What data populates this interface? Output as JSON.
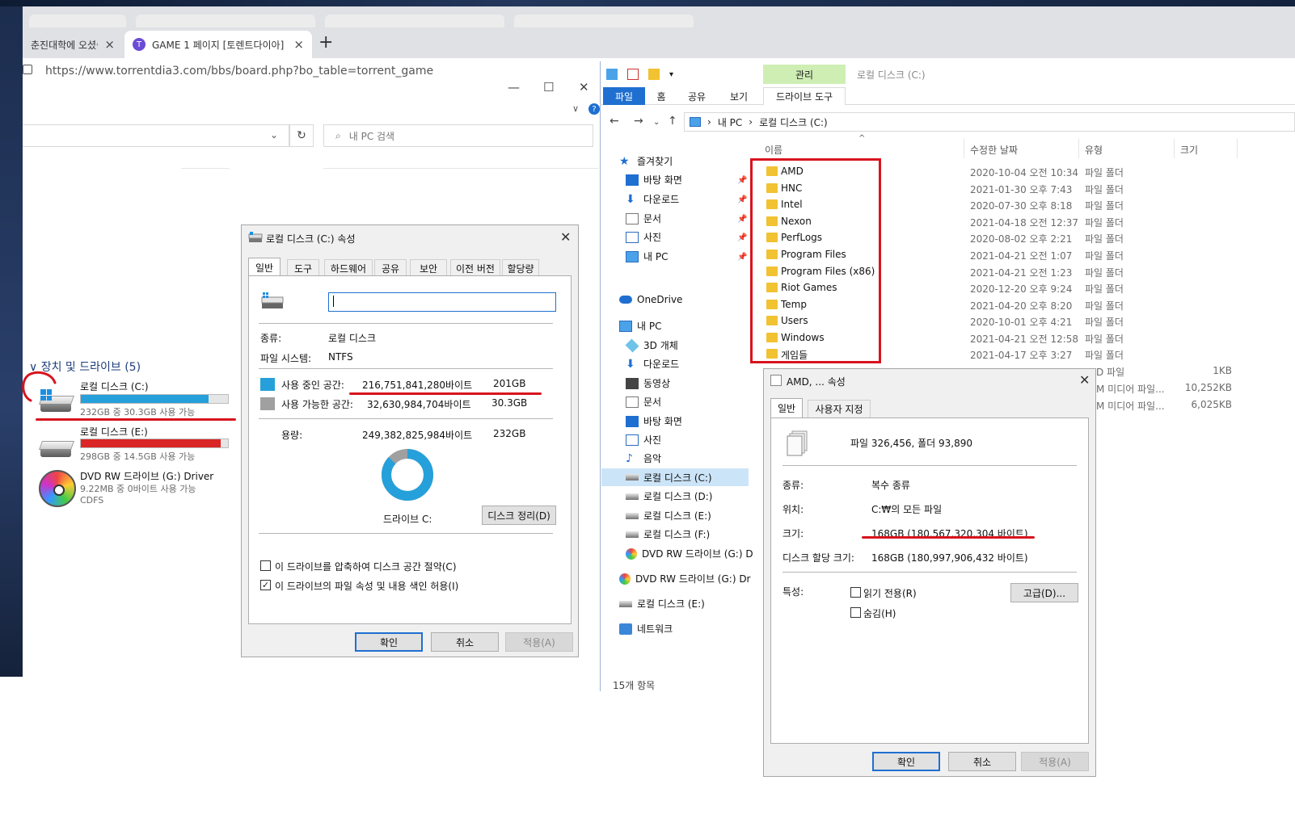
{
  "browser": {
    "tabs": [
      {
        "label": "춘진대학에 오셨습니"
      },
      {
        "label": "GAME 1 페이지 [토렌트다이아]"
      }
    ],
    "new_tab": "+",
    "close_glyph": "×",
    "favicon_letter": "T",
    "url": "https://www.torrentdia3.com/bbs/board.php?bo_table=torrent_game"
  },
  "pc_window": {
    "search_placeholder": "내 PC 검색",
    "section_title": "장치 및 드라이브 (5)",
    "drives": [
      {
        "name": "로컬 디스크 (C:)",
        "detail": "232GB 중 30.3GB 사용 가능",
        "used_fraction": 0.87,
        "bar_color": "#26a0da"
      },
      {
        "name": "로컬 디스크 (E:)",
        "detail": "298GB 중 14.5GB 사용 가능",
        "used_fraction": 0.95,
        "bar_color": "#da2626"
      },
      {
        "name": "DVD RW 드라이브 (G:) Driver",
        "detail": "9.22MB 중 0바이트 사용 가능",
        "detail2": "CDFS"
      }
    ]
  },
  "props_c": {
    "title": "로컬 디스크 (C:) 속성",
    "tabs": [
      "일반",
      "도구",
      "하드웨어",
      "공유",
      "보안",
      "이전 버전",
      "할당량"
    ],
    "name_value": "",
    "type_label": "종류:",
    "type_value": "로컬 디스크",
    "fs_label": "파일 시스템:",
    "fs_value": "NTFS",
    "used_label": "사용 중인 공간:",
    "used_bytes": "216,751,841,280바이트",
    "used_gb": "201GB",
    "free_label": "사용 가능한 공간:",
    "free_bytes": "32,630,984,704바이트",
    "free_gb": "30.3GB",
    "cap_label": "용량:",
    "cap_bytes": "249,382,825,984바이트",
    "cap_gb": "232GB",
    "used_fraction": 0.869,
    "used_color": "#26a0da",
    "free_color": "#a0a0a0",
    "drive_label": "드라이브 C:",
    "cleanup": "디스크 정리(D)",
    "compress": "이 드라이브를 압축하여 디스크 공간 절약(C)",
    "index": "이 드라이브의 파일 속성 및 내용 색인 허용(I)",
    "compress_checked": false,
    "index_checked": true,
    "ok": "확인",
    "cancel": "취소",
    "apply": "적용(A)"
  },
  "explorer": {
    "title": "로컬 디스크 (C:)",
    "context_tab": "관리",
    "ribbon_tabs": [
      "파일",
      "홈",
      "공유",
      "보기",
      "드라이브 도구"
    ],
    "breadcrumb": [
      "내 PC",
      "로컬 디스크 (C:)"
    ],
    "columns": [
      "이름",
      "수정한 날짜",
      "유형",
      "크기"
    ],
    "nav": [
      {
        "label": "즐겨찾기"
      },
      {
        "label": "바탕 화면"
      },
      {
        "label": "다운로드"
      },
      {
        "label": "문서"
      },
      {
        "label": "사진"
      },
      {
        "label": "내 PC"
      },
      {
        "label": "OneDrive"
      },
      {
        "label": "내 PC"
      },
      {
        "label": "3D 개체"
      },
      {
        "label": "다운로드"
      },
      {
        "label": "동영상"
      },
      {
        "label": "문서"
      },
      {
        "label": "바탕 화면"
      },
      {
        "label": "사진"
      },
      {
        "label": "음악"
      },
      {
        "label": "로컬 디스크 (C:)"
      },
      {
        "label": "로컬 디스크 (D:)"
      },
      {
        "label": "로컬 디스크 (E:)"
      },
      {
        "label": "로컬 디스크 (F:)"
      },
      {
        "label": "DVD RW 드라이브 (G:) D"
      },
      {
        "label": "DVD RW 드라이브 (G:) Dr"
      },
      {
        "label": "로컬 디스크 (E:)"
      },
      {
        "label": "네트워크"
      }
    ],
    "files": [
      {
        "name": "AMD",
        "date": "2020-10-04 오전 10:34",
        "type": "파일 폴더"
      },
      {
        "name": "HNC",
        "date": "2021-01-30 오후 7:43",
        "type": "파일 폴더"
      },
      {
        "name": "Intel",
        "date": "2020-07-30 오후 8:18",
        "type": "파일 폴더"
      },
      {
        "name": "Nexon",
        "date": "2021-04-18 오전 12:37",
        "type": "파일 폴더"
      },
      {
        "name": "PerfLogs",
        "date": "2020-08-02 오후 2:21",
        "type": "파일 폴더"
      },
      {
        "name": "Program Files",
        "date": "2021-04-21 오전 1:07",
        "type": "파일 폴더"
      },
      {
        "name": "Program Files (x86)",
        "date": "2021-04-21 오전 1:23",
        "type": "파일 폴더"
      },
      {
        "name": "Riot Games",
        "date": "2020-12-20 오후 9:24",
        "type": "파일 폴더"
      },
      {
        "name": "Temp",
        "date": "2021-04-20 오후 8:20",
        "type": "파일 폴더"
      },
      {
        "name": "Users",
        "date": "2020-10-01 오후 4:21",
        "type": "파일 폴더"
      },
      {
        "name": "Windows",
        "date": "2021-04-21 오전 12:58",
        "type": "파일 폴더"
      },
      {
        "name": "게임들",
        "date": "2021-04-17 오후 3:27",
        "type": "파일 폴더"
      }
    ],
    "partial_rows": [
      {
        "type": "D 파일",
        "size": "1KB"
      },
      {
        "type": "M 미디어 파일...",
        "size": "10,252KB"
      },
      {
        "type": "M 미디어 파일...",
        "size": "6,025KB"
      }
    ],
    "status": "15개 항목"
  },
  "props_multi": {
    "title": "AMD, ... 속성",
    "tabs": [
      "일반",
      "사용자 지정"
    ],
    "summary": "파일 326,456, 폴더 93,890",
    "type_label": "종류:",
    "type_value": "복수 종류",
    "loc_label": "위치:",
    "loc_value": "C:₩의 모든 파일",
    "size_label": "크기:",
    "size_value": "168GB (180,567,320,304 바이트)",
    "disk_label": "디스크 할당 크기:",
    "disk_value": "168GB (180,997,906,432 바이트)",
    "attr_label": "특성:",
    "readonly": "읽기 전용(R)",
    "hidden": "숨김(H)",
    "advanced": "고급(D)...",
    "ok": "확인",
    "cancel": "취소",
    "apply": "적용(A)"
  }
}
